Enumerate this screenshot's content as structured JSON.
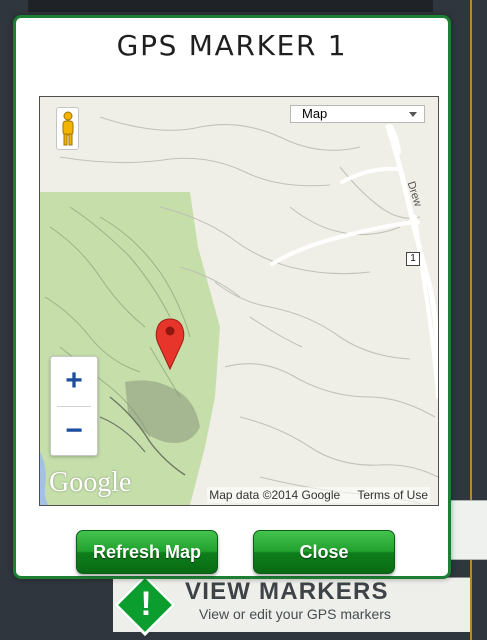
{
  "dialog": {
    "title": "GPS MARKER 1",
    "buttons": {
      "refresh_label": "Refresh Map",
      "close_label": "Close"
    },
    "accent_color": "#1c7f33",
    "button_color": "#139327"
  },
  "map": {
    "type_selector": {
      "selected": "Map",
      "icon": "chevron-down-icon"
    },
    "zoom": {
      "in_label": "+",
      "out_label": "−"
    },
    "pegman_icon": "pegman-icon",
    "marker_icon": "map-pin-icon",
    "marker_color": "#e8352b",
    "road_shield": "1",
    "road_label": "Drew",
    "logo": "Google",
    "attribution": {
      "data": "Map data ©2014 Google",
      "terms": "Terms of Use"
    },
    "park_color": "#c5deaa",
    "land_color": "#f0efe7"
  },
  "background_section": {
    "icon": "warning-diamond-icon",
    "icon_mark": "!",
    "title": "VIEW MARKERS",
    "subtitle": "View or edit your GPS markers"
  }
}
